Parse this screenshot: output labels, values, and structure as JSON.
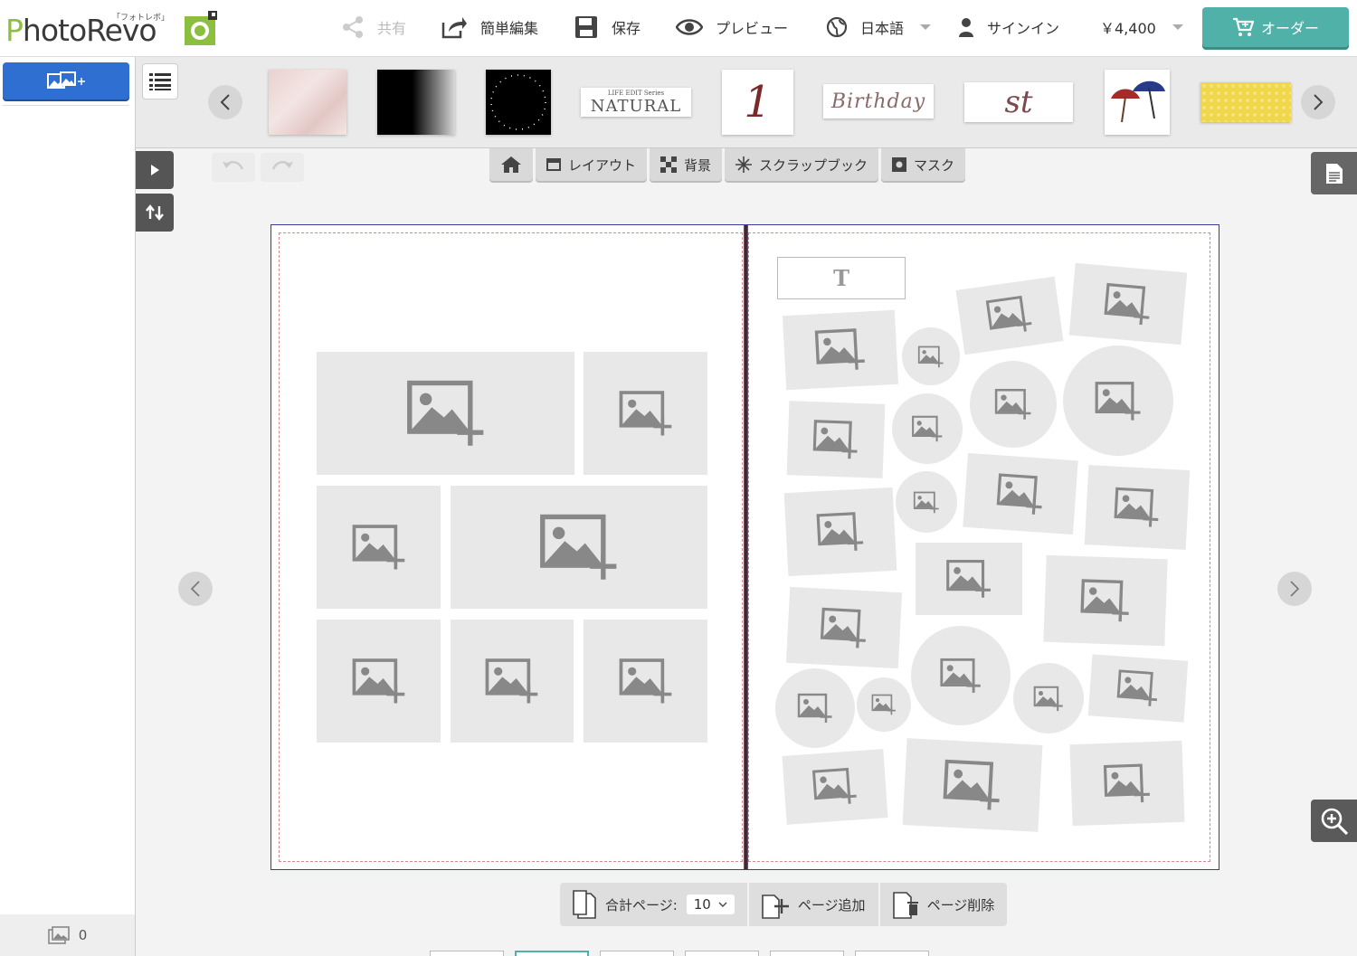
{
  "header": {
    "logo_text": "PhotoRevo",
    "logo_ruby": "「フォトレボ」",
    "nav": {
      "share": "共有",
      "easy_edit": "簡単編集",
      "save": "保存",
      "preview": "プレビュー",
      "language": "日本語",
      "signin": "サインイン",
      "price": "￥4,400"
    },
    "order_label": "オーダー",
    "accent_color": "#4fb1a8"
  },
  "sidebar": {
    "add_photo_icon": "add-photo-icon",
    "photo_count": "0"
  },
  "thumbnails": {
    "items": [
      {
        "name": "pink-marble",
        "text": ""
      },
      {
        "name": "black-fade",
        "text": ""
      },
      {
        "name": "black-dots-frame",
        "text": ""
      },
      {
        "name": "natural",
        "text": "NATURAL",
        "subtext": "LIFE EDIT Series"
      },
      {
        "name": "number-one",
        "text": "1"
      },
      {
        "name": "birthday",
        "text": "Birthday"
      },
      {
        "name": "st",
        "text": "st"
      },
      {
        "name": "umbrellas",
        "text": ""
      },
      {
        "name": "yellow-dots",
        "text": ""
      }
    ]
  },
  "tabs": [
    {
      "id": "home",
      "label": ""
    },
    {
      "id": "layout",
      "label": "レイアウト"
    },
    {
      "id": "background",
      "label": "背景"
    },
    {
      "id": "scrapbook",
      "label": "スクラップブック"
    },
    {
      "id": "mask",
      "label": "マスク"
    }
  ],
  "spread": {
    "text_slot_label": "T"
  },
  "page_bar": {
    "total_pages_label": "合計ページ:",
    "total_pages_value": "10",
    "add_page": "ページ追加",
    "delete_page": "ページ削除"
  }
}
